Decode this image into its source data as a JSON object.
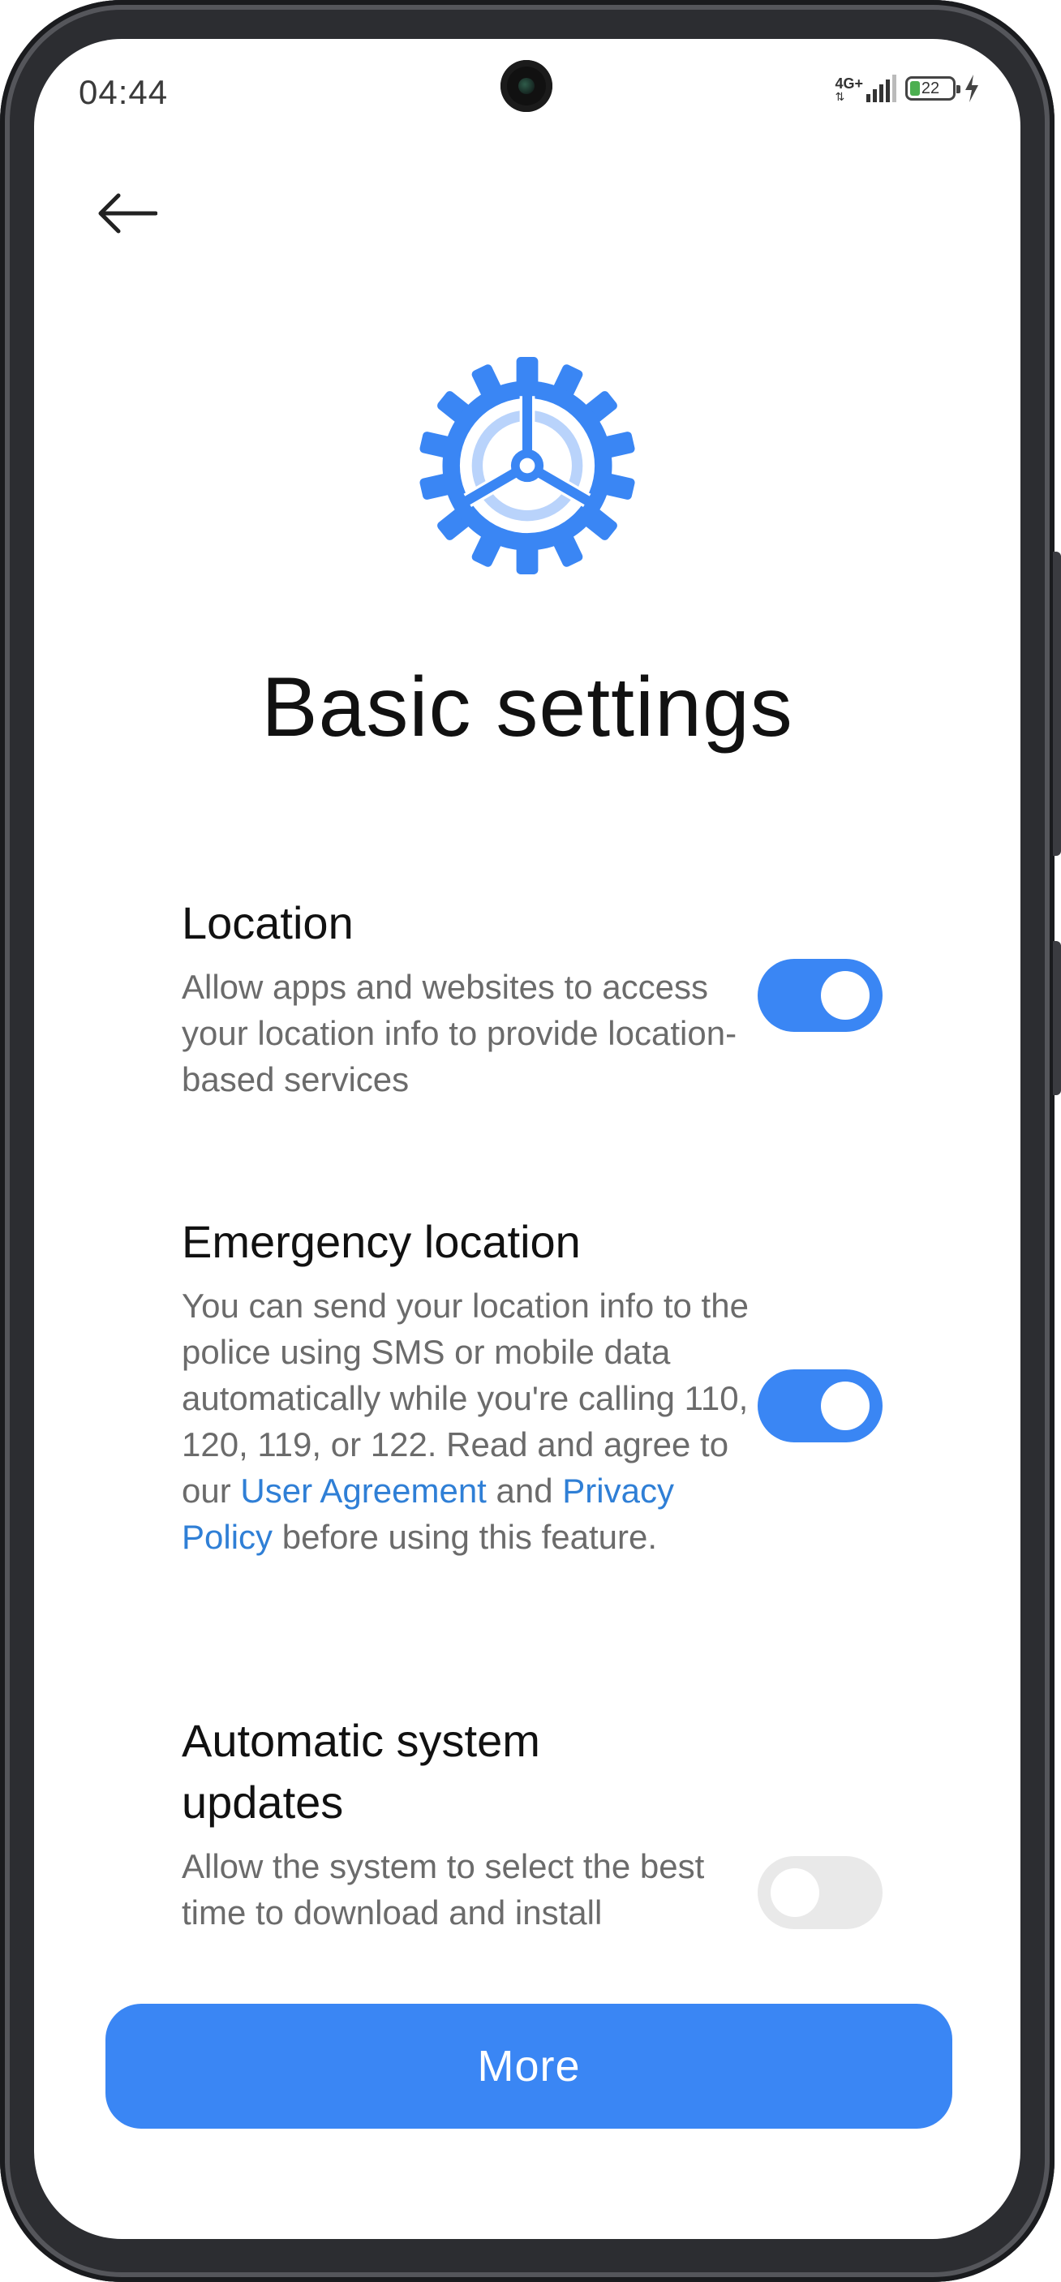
{
  "status_bar": {
    "time": "04:44",
    "network": "4G+",
    "battery_level": "22",
    "battery_color": "#4caf50"
  },
  "header": {
    "back_icon": "arrow-left-icon"
  },
  "hero": {
    "icon": "gear-icon",
    "accent_color": "#3a86f4",
    "title": "Basic settings"
  },
  "settings": [
    {
      "title": "Location",
      "description": "Allow apps and websites to access your location info to provide location-based services",
      "enabled": true
    },
    {
      "title": "Emergency location",
      "description_parts": {
        "before_link1": "You can send your location info to the police using SMS or mobile data automatically while you're calling 110, 120, 119, or 122. Read and agree to our ",
        "link1": "User Agreement",
        "between_links": " and ",
        "link2": "Privacy Policy",
        "after_link2": " before using this feature."
      },
      "enabled": true
    },
    {
      "title": "Automatic system updates",
      "description": "Allow the system to select the best time to download and install",
      "enabled": false
    }
  ],
  "footer": {
    "more_label": "More"
  }
}
